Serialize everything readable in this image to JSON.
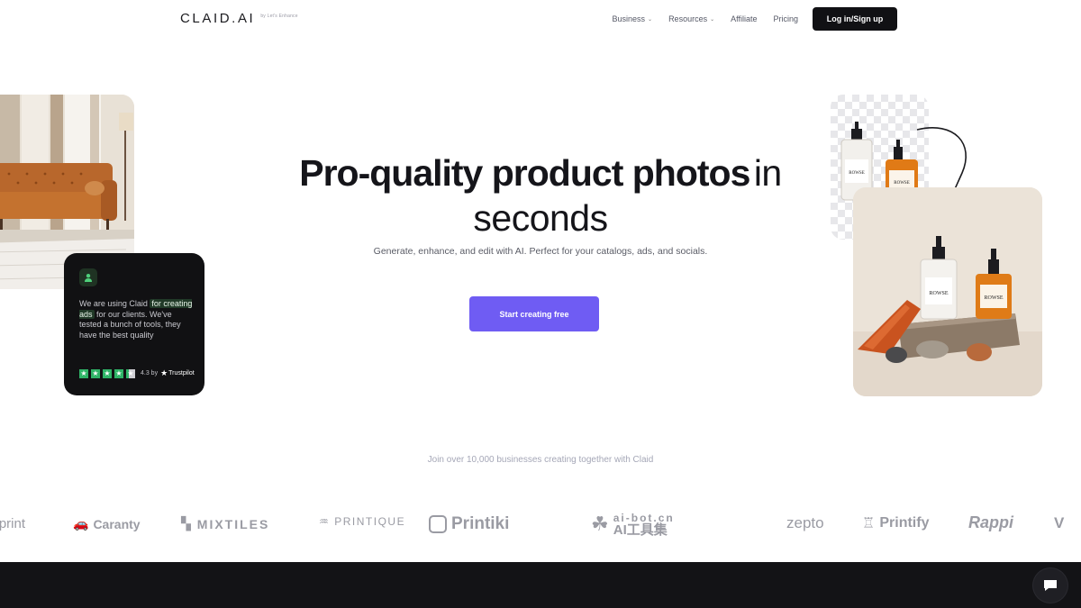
{
  "nav": {
    "logo": "CLAID.AI",
    "logo_sub": "by Let's Enhance",
    "items": [
      {
        "label": "Business",
        "has_dropdown": true
      },
      {
        "label": "Resources",
        "has_dropdown": true
      },
      {
        "label": "Affiliate",
        "has_dropdown": false
      },
      {
        "label": "Pricing",
        "has_dropdown": false
      }
    ],
    "login_label": "Log in/Sign up"
  },
  "hero": {
    "title_bold": "Pro-quality product photos",
    "title_light_1": "in",
    "title_light_2": "seconds",
    "subtitle": "Generate, enhance, and edit with AI. Perfect for your catalogs, ads, and socials.",
    "cta_label": "Start creating free"
  },
  "testimonial": {
    "quote_before": "We are using Claid",
    "quote_highlight": "for creating ads",
    "quote_after": "for our clients. We've tested a bunch of tools, they have the best quality",
    "rating": "4.3 by",
    "rating_source": "Trustpilot",
    "stars": 4.3
  },
  "product_label": "ROWSE",
  "social_proof": {
    "text": "Join over 10,000 businesses creating together with Claid",
    "brands": [
      "vistaprint",
      "Caranty",
      "MIXTILES",
      "PRINTIQUE",
      "Printiki",
      "ai-bot.cn",
      "AI工具集",
      "zepto",
      "Printify",
      "Rappi",
      "V"
    ]
  },
  "colors": {
    "accent": "#6f5cf3",
    "dark": "#111113",
    "trustpilot_green": "#2fb467"
  }
}
